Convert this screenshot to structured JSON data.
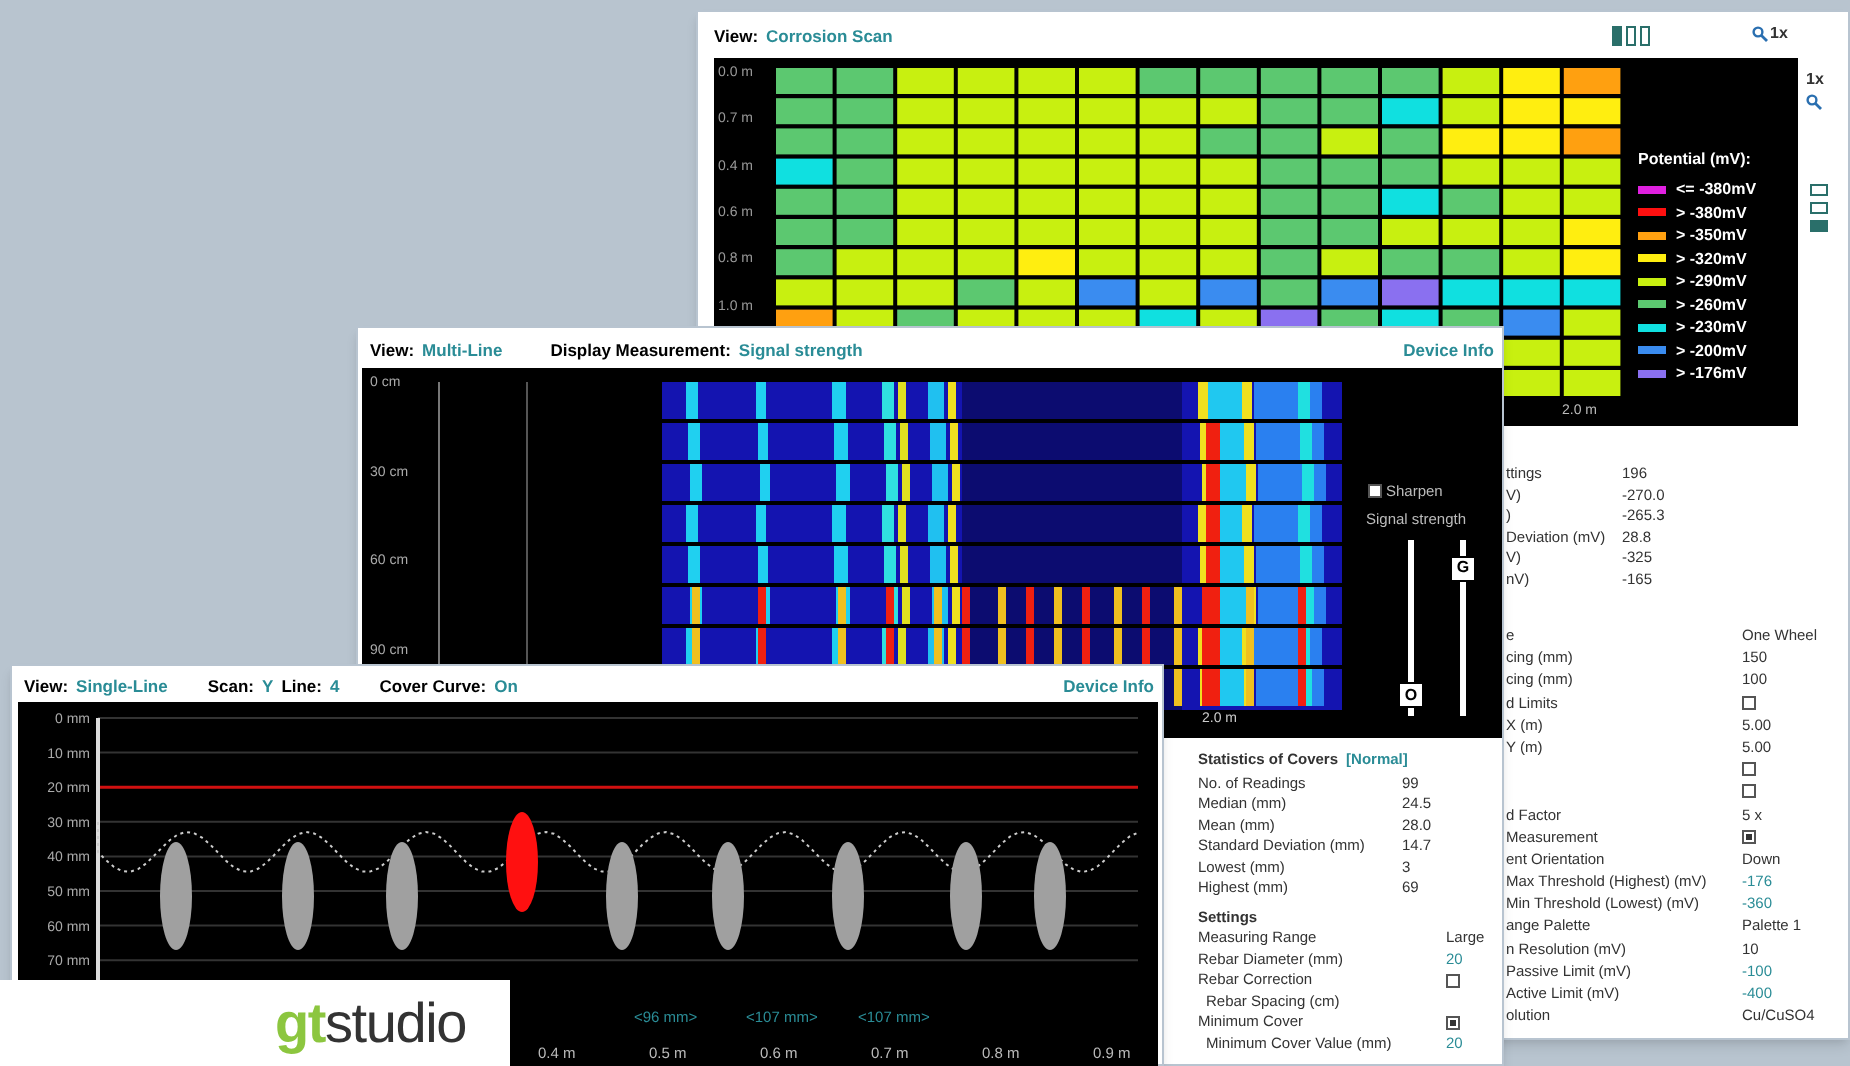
{
  "corrosion_window": {
    "view_label": "View:",
    "view": "Corrosion Scan",
    "zoom": "1x",
    "side_zoom": "1x",
    "y_ticks": [
      "0.0 m",
      "0.7 m",
      "0.4 m",
      "0.6 m",
      "0.8 m",
      "1.0 m"
    ],
    "x_tick": "2.0 m",
    "legend_title": "Potential (mV):",
    "legend": [
      {
        "label": "<= -380mV",
        "color": "#e020e0"
      },
      {
        "label": "> -380mV",
        "color": "#ff1010"
      },
      {
        "label": "> -350mV",
        "color": "#ffa010"
      },
      {
        "label": "> -320mV",
        "color": "#ffee10"
      },
      {
        "label": "> -290mV",
        "color": "#c8f010"
      },
      {
        "label": "> -260mV",
        "color": "#5cc870"
      },
      {
        "label": "> -230mV",
        "color": "#10e0e0"
      },
      {
        "label": "> -200mV",
        "color": "#3a8cf0"
      },
      {
        "label": "> -176mV",
        "color": "#8a70f0"
      }
    ],
    "statistics": [
      {
        "label": "ttings",
        "value": "196"
      },
      {
        "label": "V)",
        "value": "-270.0"
      },
      {
        "label": ")",
        "value": "-265.3"
      },
      {
        "label": "Deviation (mV)",
        "value": "28.8"
      },
      {
        "label": "V)",
        "value": "-325"
      },
      {
        "label": "nV)",
        "value": "-165"
      }
    ],
    "settings": [
      {
        "label": "e",
        "kind": "text",
        "value": "One Wheel"
      },
      {
        "label": "cing (mm)",
        "kind": "text",
        "value": "150"
      },
      {
        "label": "cing (mm)",
        "kind": "text",
        "value": "100"
      },
      {
        "label": "d Limits",
        "kind": "checkbox",
        "checked": false
      },
      {
        "label": "X (m)",
        "kind": "text",
        "value": "5.00"
      },
      {
        "label": "Y (m)",
        "kind": "text",
        "value": "5.00"
      },
      {
        "kind": "checkbox",
        "checked": false
      },
      {
        "kind": "checkbox",
        "checked": false
      },
      {
        "label": "d Factor",
        "kind": "text",
        "value": "5 x"
      },
      {
        "label": "Measurement",
        "kind": "checkbox",
        "checked": true
      },
      {
        "label": "ent Orientation",
        "kind": "text",
        "value": "Down"
      },
      {
        "label": "Max Threshold (Highest) (mV)",
        "kind": "editable",
        "value": "-176"
      },
      {
        "label": "Min Threshold (Lowest) (mV)",
        "kind": "editable",
        "value": "-360"
      },
      {
        "label": "ange Palette",
        "kind": "text",
        "value": "Palette 1"
      },
      {
        "label": "n Resolution (mV)",
        "kind": "text",
        "value": "10"
      },
      {
        "label": "Passive Limit (mV)",
        "kind": "editable",
        "value": "-100"
      },
      {
        "label": "Active Limit (mV)",
        "kind": "editable",
        "value": "-400"
      },
      {
        "label": "olution",
        "kind": "text",
        "value": "Cu/CuSO4"
      }
    ]
  },
  "multi_line_window": {
    "view_label": "View:",
    "view": "Multi-Line",
    "display_label": "Display Measurement:",
    "display": "Signal strength",
    "device_info": "Device Info",
    "y_ticks": [
      "0 cm",
      "30 cm",
      "60 cm",
      "90 cm"
    ],
    "x_tick": "2.0 m",
    "sharpen": {
      "label": "Sharpen",
      "checked": false
    },
    "scale_label": "Signal strength",
    "sliders": [
      {
        "label": "O",
        "level": 0.05
      },
      {
        "label": "G",
        "level": 0.9
      }
    ],
    "stats_title": "Statistics of Covers",
    "stats_status": "[Normal]",
    "stats": [
      {
        "label": "No. of Readings",
        "value": "99"
      },
      {
        "label": "Median (mm)",
        "value": "24.5"
      },
      {
        "label": "Mean (mm)",
        "value": "28.0"
      },
      {
        "label": "Standard Deviation (mm)",
        "value": "14.7"
      },
      {
        "label": "Lowest (mm)",
        "value": "3"
      },
      {
        "label": "Highest (mm)",
        "value": "69"
      }
    ],
    "settings_title": "Settings",
    "settings": [
      {
        "label": "Measuring Range",
        "kind": "text",
        "value": "Large"
      },
      {
        "label": "Rebar Diameter (mm)",
        "kind": "editable",
        "value": "20"
      },
      {
        "label": "Rebar Correction",
        "kind": "checkbox",
        "checked": false,
        "children": [
          {
            "label": "Rebar Spacing (cm)",
            "kind": "text"
          }
        ]
      },
      {
        "label": "Minimum Cover",
        "kind": "checkbox",
        "checked": true,
        "children": [
          {
            "label": "Minimum Cover Value (mm)",
            "kind": "editable",
            "value": "20"
          }
        ]
      }
    ]
  },
  "single_line_window": {
    "view_label": "View:",
    "view": "Single-Line",
    "scan_label": "Scan:",
    "scan": "Y",
    "line_label": "Line:",
    "line": "4",
    "cover_curve_label": "Cover Curve:",
    "cover_curve": "On",
    "device_info": "Device Info",
    "y_ticks": [
      "0 mm",
      "10 mm",
      "20 mm",
      "30 mm",
      "40 mm",
      "50 mm",
      "60 mm",
      "70 mm"
    ],
    "x_ticks": [
      "0.4 m",
      "0.5 m",
      "0.6 m",
      "0.7 m",
      "0.8 m",
      "0.9 m"
    ],
    "spacings": [
      "<96 mm>",
      "<107 mm>",
      "<107 mm>"
    ],
    "rebars": [
      {
        "highlighted": false
      },
      {
        "highlighted": false
      },
      {
        "highlighted": false
      },
      {
        "highlighted": true
      },
      {
        "highlighted": false
      },
      {
        "highlighted": false
      },
      {
        "highlighted": false
      },
      {
        "highlighted": false
      },
      {
        "highlighted": false
      }
    ]
  },
  "logo": {
    "prefix": "gt",
    "name": "studio"
  }
}
